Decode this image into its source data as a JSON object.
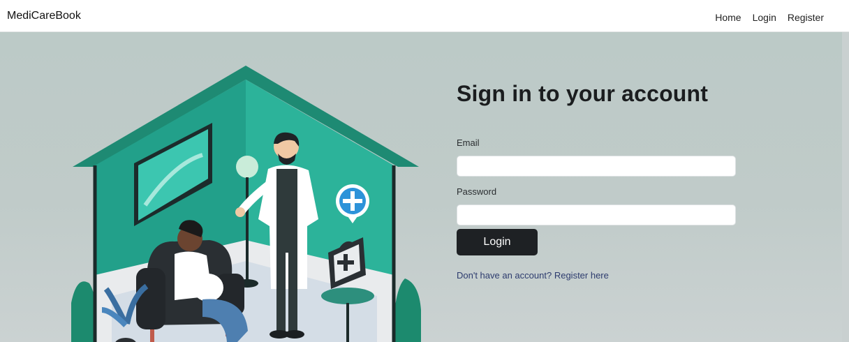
{
  "navbar": {
    "brand": "MediCareBook",
    "links": [
      {
        "label": "Home"
      },
      {
        "label": "Login"
      },
      {
        "label": "Register"
      }
    ]
  },
  "login": {
    "title": "Sign in to your account",
    "email_label": "Email",
    "email_value": "",
    "password_label": "Password",
    "password_value": "",
    "submit_label": "Login",
    "register_prompt": "Don't have an account?",
    "register_link": "Register here"
  },
  "illustration": {
    "description_icons": [
      "house-icon",
      "doctor-icon",
      "patient-icon",
      "medical-cross-icon",
      "medical-kit-icon",
      "plant-icon",
      "lamp-icon"
    ]
  },
  "colors": {
    "background": "#bfcac8",
    "teal": "#1f8f7b",
    "teal_light": "#23a78d",
    "button": "#1e2124",
    "link": "#2d3b6e"
  }
}
